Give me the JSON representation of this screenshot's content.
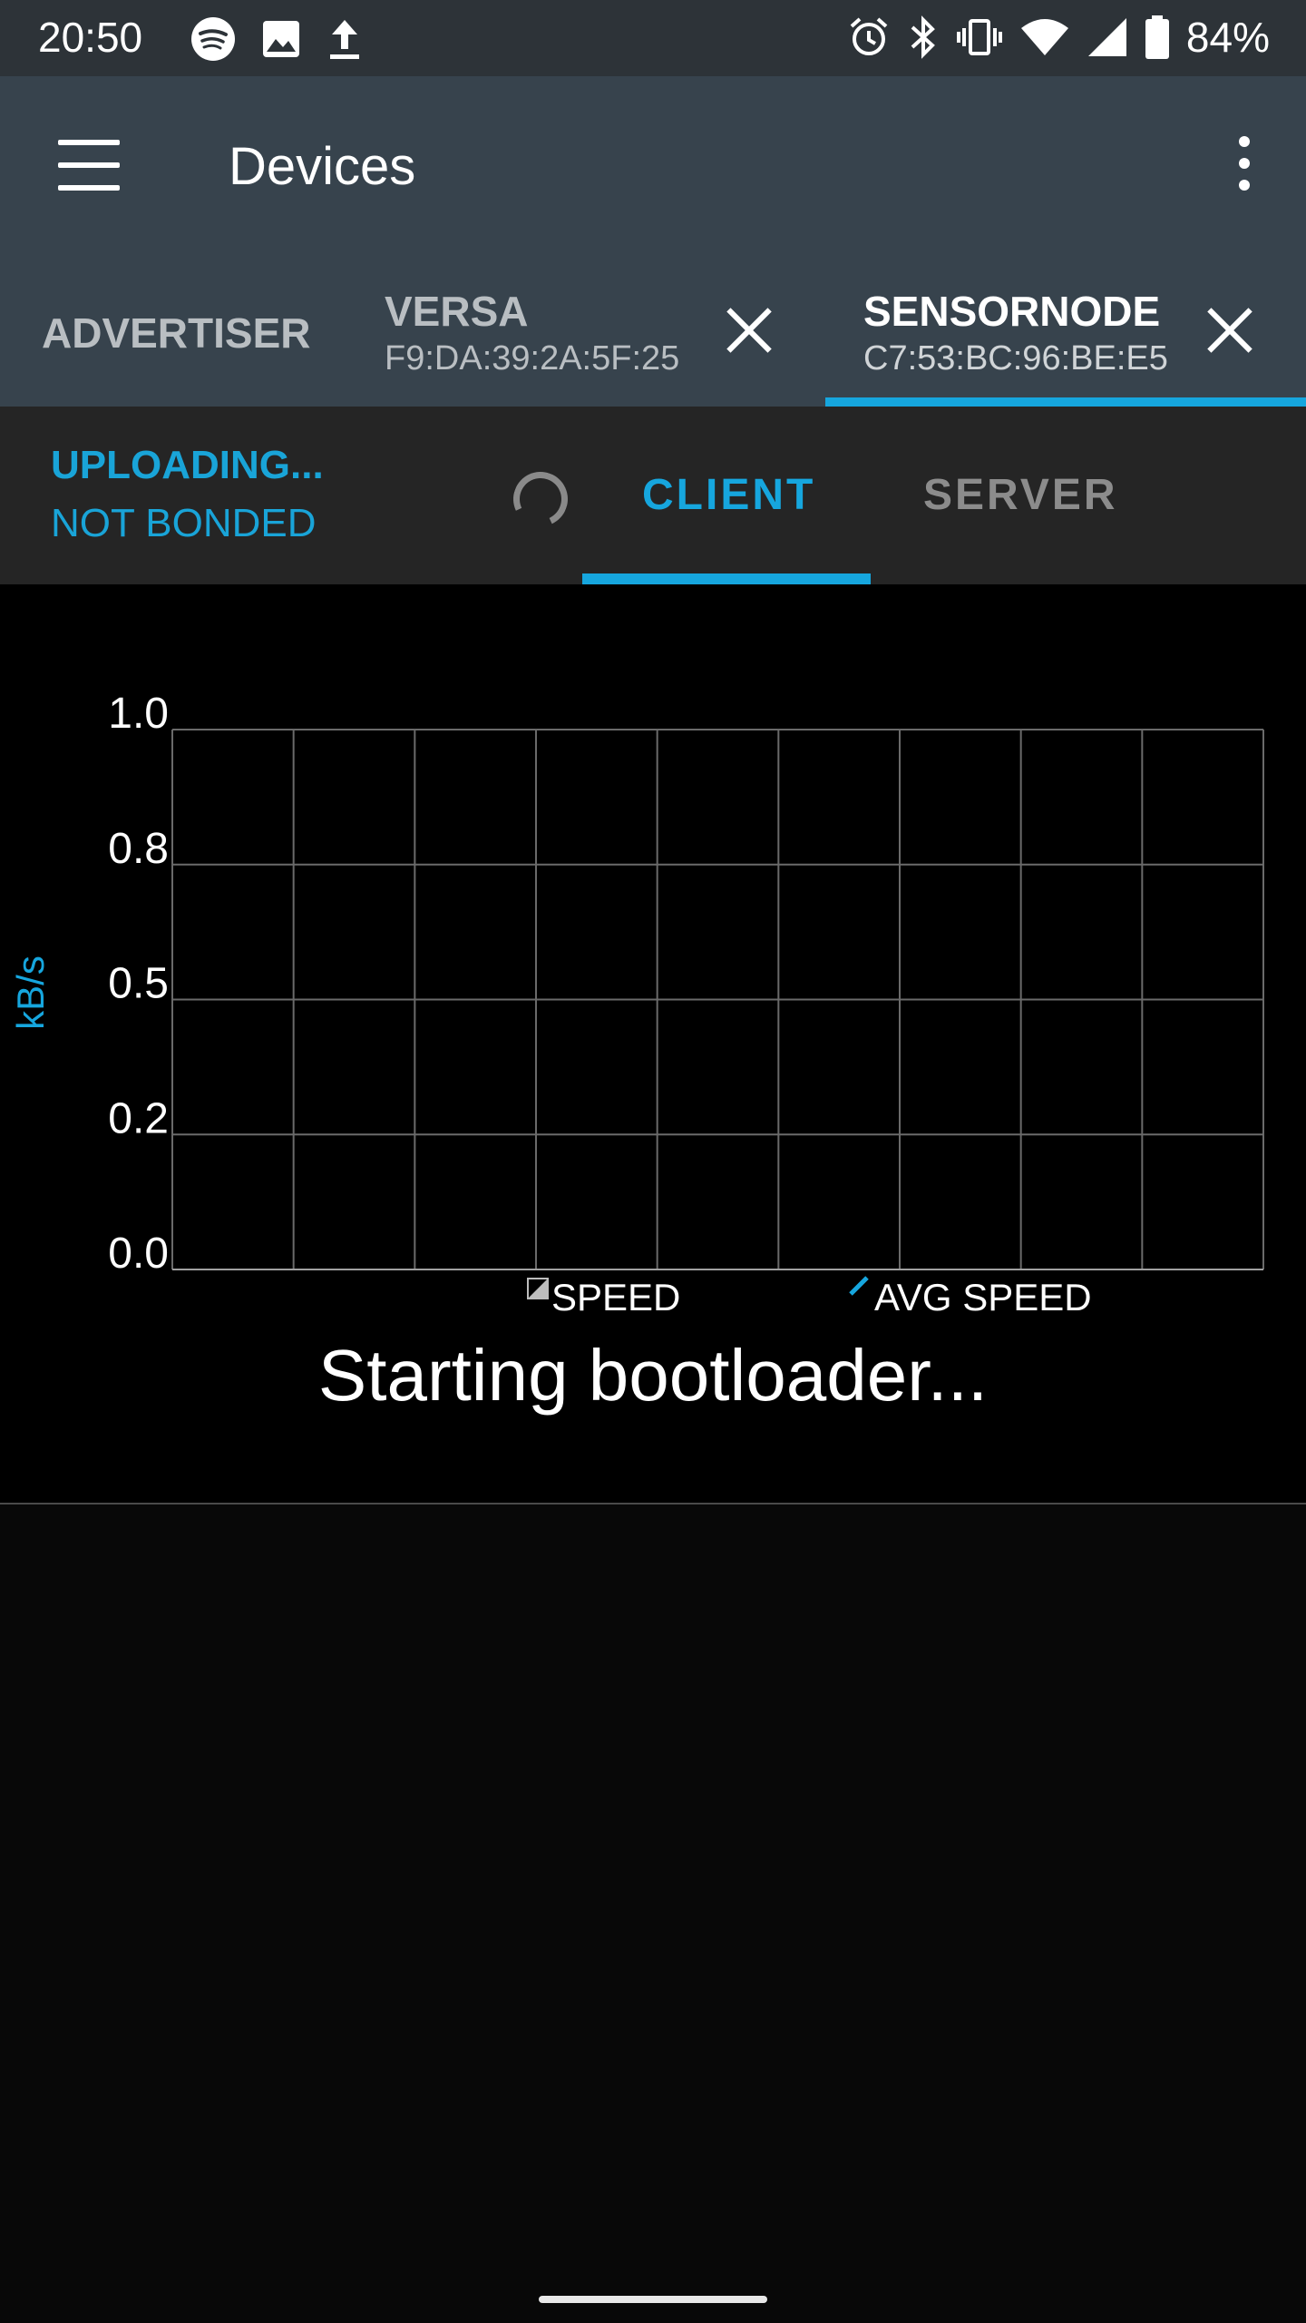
{
  "statusbar": {
    "time": "20:50",
    "battery": "84%",
    "left_icons": [
      "spotify-icon",
      "image-icon",
      "upload-icon"
    ],
    "right_icons": [
      "alarm-icon",
      "bluetooth-icon",
      "vibrate-icon",
      "wifi-icon",
      "signal-icon",
      "battery-icon"
    ]
  },
  "toolbar": {
    "title": "Devices"
  },
  "device_tabs": [
    {
      "name": "ADVERTISER",
      "mac": ""
    },
    {
      "name": "VERSA",
      "mac": "F9:DA:39:2A:5F:25"
    },
    {
      "name": "SENSORNODE",
      "mac": "C7:53:BC:96:BE:E5",
      "selected": true
    }
  ],
  "connection": {
    "state": "UPLOADING...",
    "bond": "NOT BONDED"
  },
  "sub_tabs": [
    {
      "label": "CLIENT",
      "selected": true
    },
    {
      "label": "SERVER",
      "selected": false
    }
  ],
  "colors": {
    "accent": "#16a6de",
    "toolbar": "#37434d",
    "statusbar": "#2d3338",
    "subbar": "#252525"
  },
  "chart_data": {
    "type": "line",
    "ylabel": "kB/s",
    "ylim": [
      0,
      1
    ],
    "yticks": [
      "0.0",
      "0.2",
      "0.5",
      "0.8",
      "1.0"
    ],
    "grid": true,
    "series": [
      {
        "name": "SPEED",
        "values": [],
        "color": "#9e9e9e"
      },
      {
        "name": "AVG SPEED",
        "values": [],
        "color": "#16a6de"
      }
    ],
    "legend": "bottom"
  },
  "progress_message": "Starting bootloader..."
}
